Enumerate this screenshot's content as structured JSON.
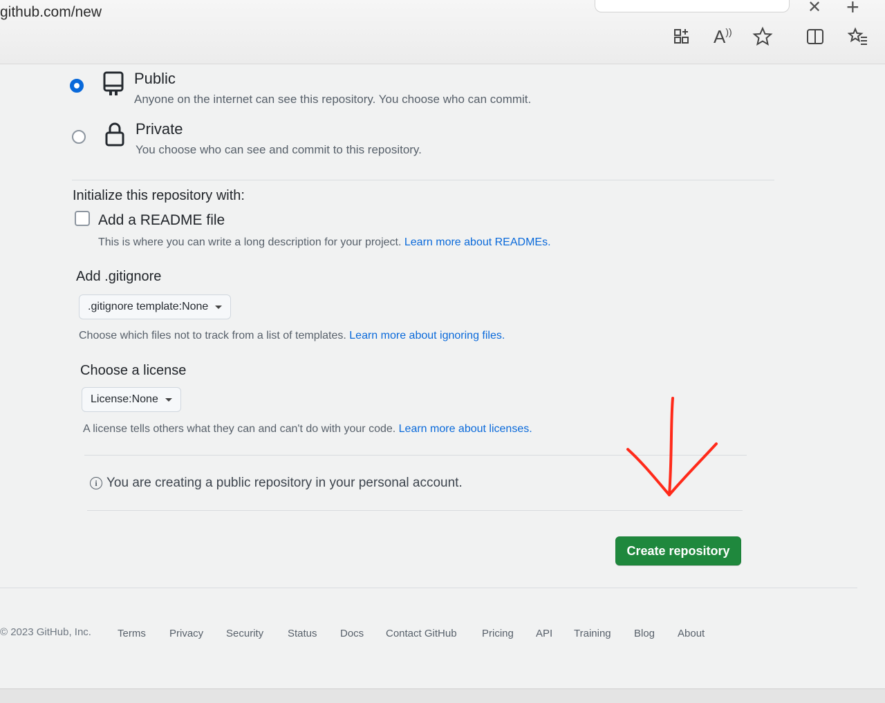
{
  "browser": {
    "url": "github.com/new"
  },
  "visibility": {
    "public": {
      "title": "Public",
      "description": "Anyone on the internet can see this repository. You choose who can commit."
    },
    "private": {
      "title": "Private",
      "description": "You choose who can see and commit to this repository."
    }
  },
  "initialize": {
    "heading": "Initialize this repository with:",
    "readme_label": "Add a README file",
    "readme_help": "This is where you can write a long description for your project.",
    "readme_link": "Learn more about READMEs."
  },
  "gitignore": {
    "heading": "Add .gitignore",
    "select_label": ".gitignore template:",
    "select_value": "None",
    "help": "Choose which files not to track from a list of templates.",
    "link": "Learn more about ignoring files."
  },
  "license": {
    "heading": "Choose a license",
    "select_label": "License:",
    "select_value": "None",
    "help": "A license tells others what they can and can't do with your code.",
    "link": "Learn more about licenses."
  },
  "notice": {
    "text": "You are creating a public repository in your personal account."
  },
  "actions": {
    "create_label": "Create repository"
  },
  "colors": {
    "primary_button": "#1f883d",
    "link": "#0969da",
    "annotation_arrow": "#ff2a1a"
  },
  "footer": {
    "copyright": "© 2023 GitHub, Inc.",
    "links": [
      "Terms",
      "Privacy",
      "Security",
      "Status",
      "Docs",
      "Contact GitHub",
      "Pricing",
      "API",
      "Training",
      "Blog",
      "About"
    ]
  }
}
